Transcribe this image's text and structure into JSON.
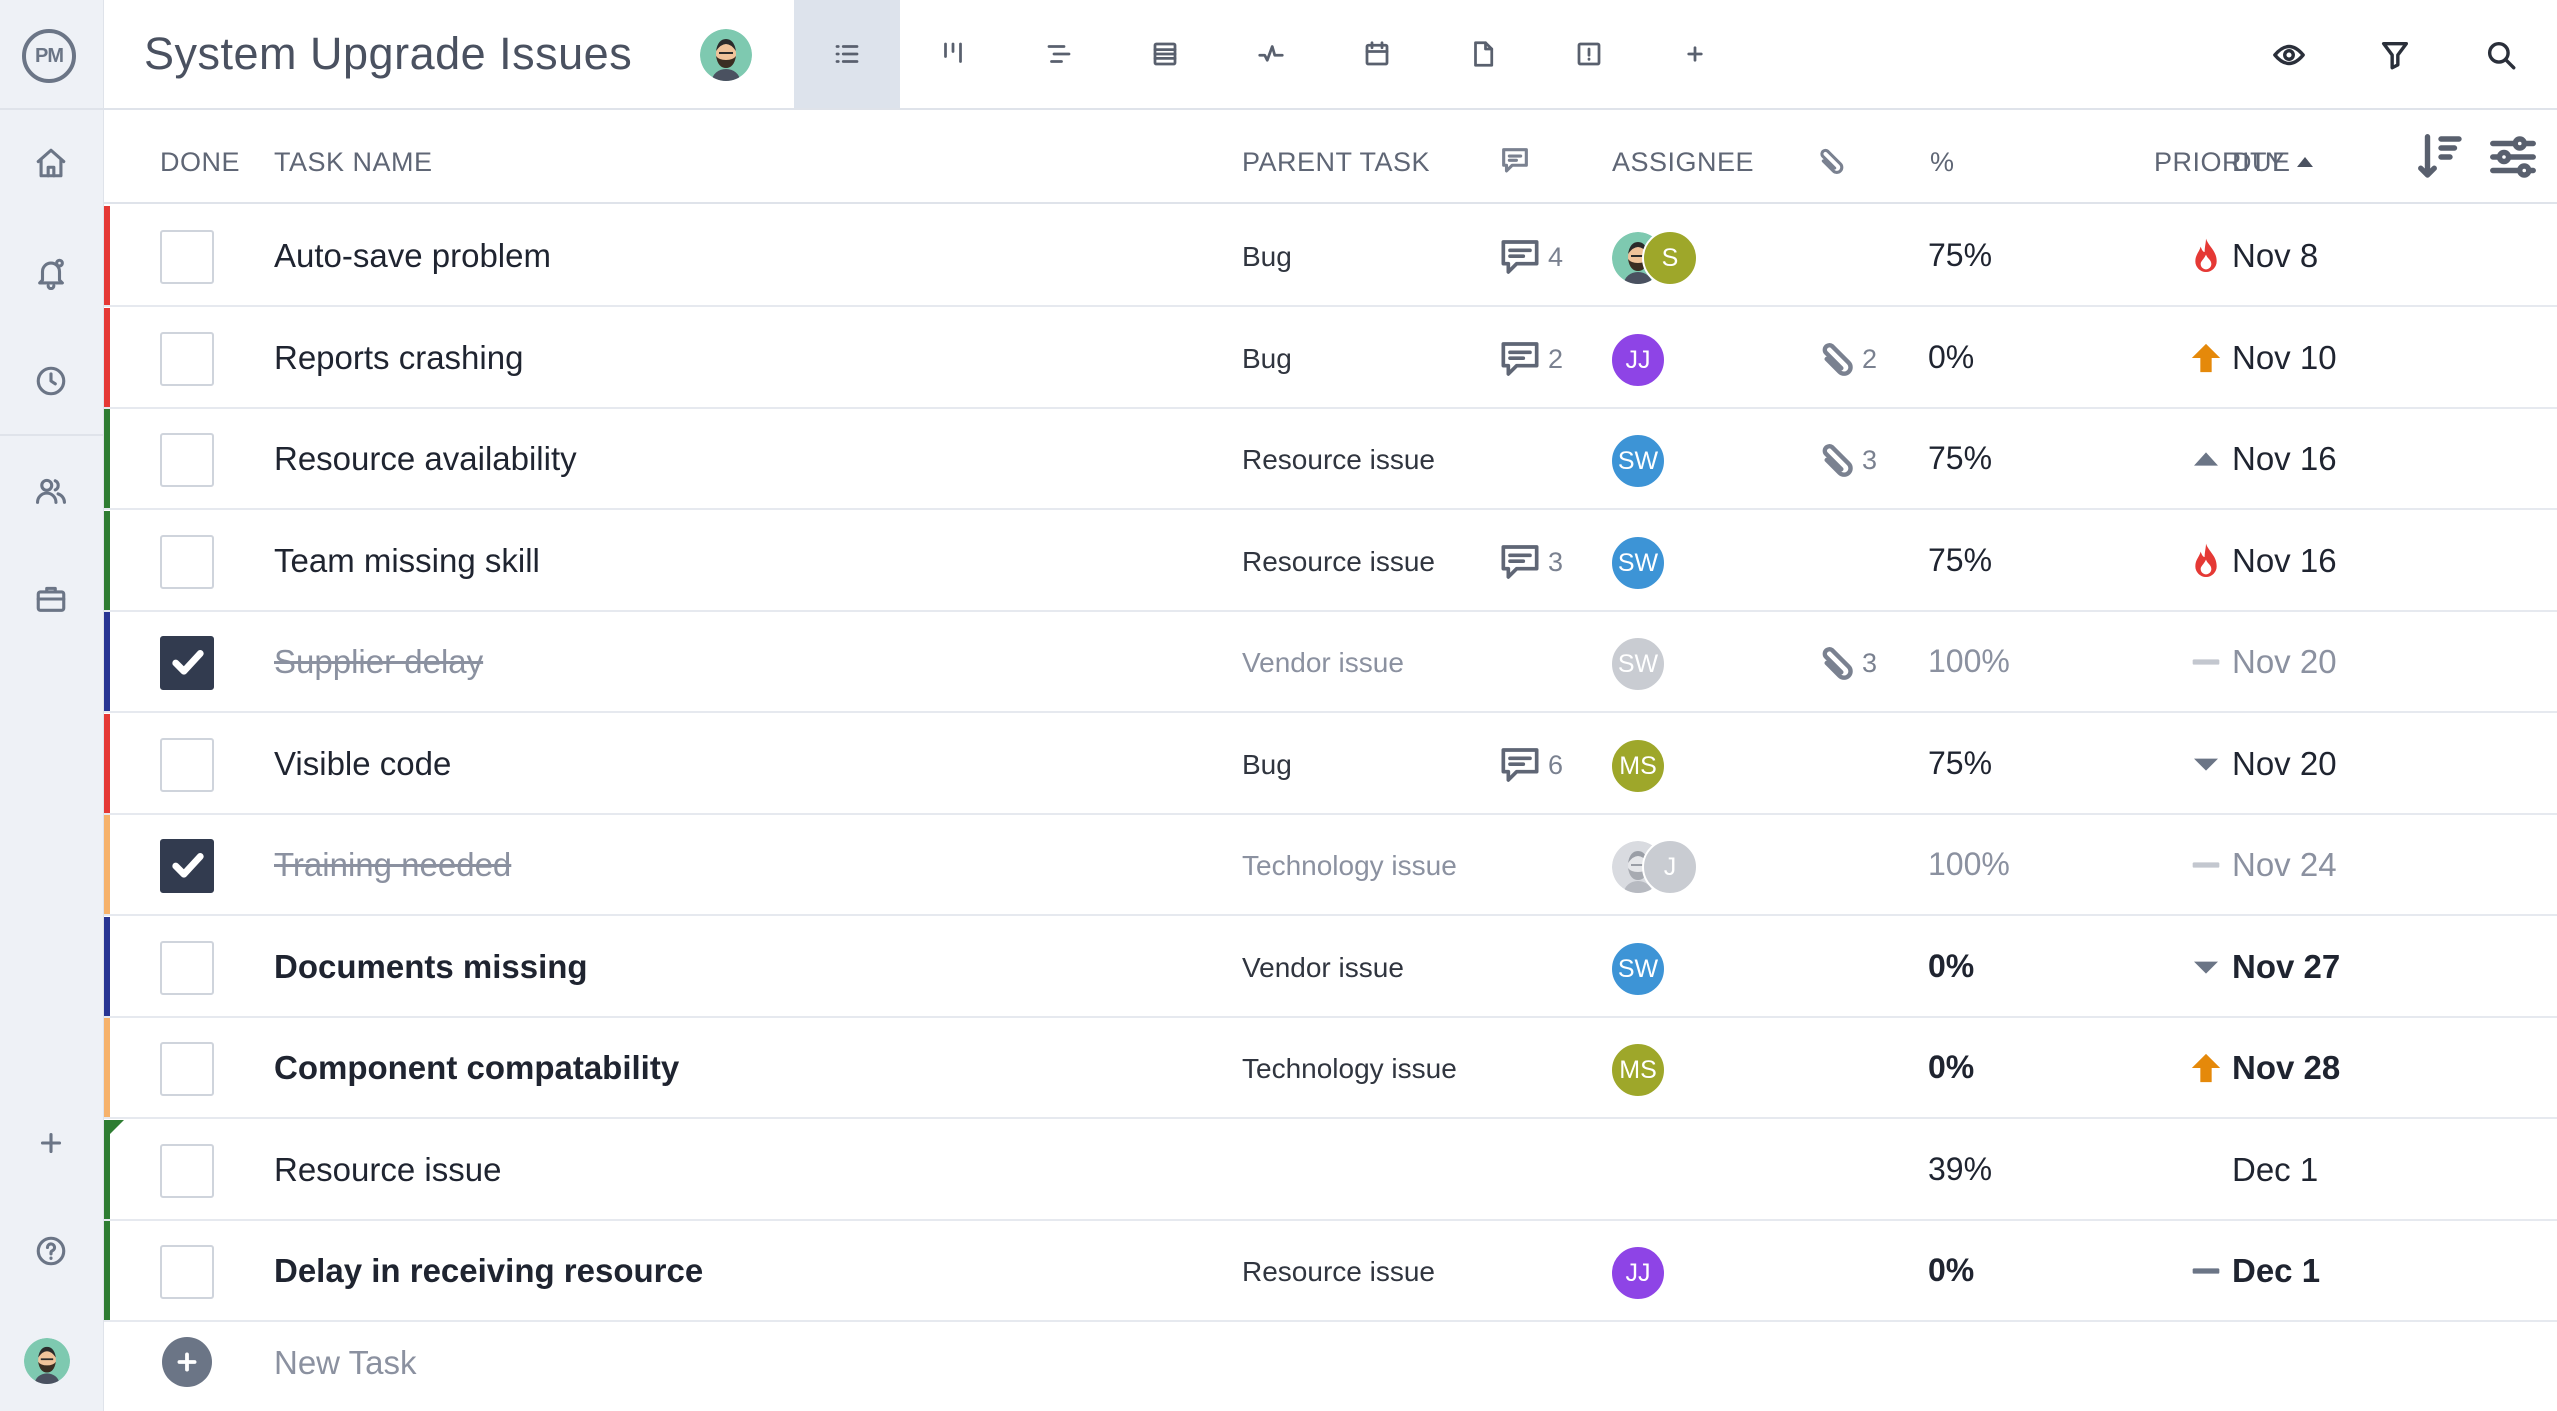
{
  "app": {
    "logo_text": "PM"
  },
  "header": {
    "title": "System Upgrade Issues",
    "views": [
      "list",
      "board",
      "gantt",
      "sheet",
      "dashboard",
      "calendar",
      "files",
      "risks",
      "add"
    ],
    "active_view": "list"
  },
  "columns": {
    "done": "DONE",
    "task_name": "TASK NAME",
    "parent_task": "PARENT TASK",
    "assignee": "ASSIGNEE",
    "percent": "%",
    "priority": "PRIORITY",
    "due": "DUE"
  },
  "colors": {
    "red": "#e53935",
    "green": "#2e7d32",
    "navy": "#283593",
    "orange": "#f6b26b",
    "assignee_purple": "#8e44e6",
    "assignee_blue": "#3d94d6",
    "assignee_olive": "#9ea72a",
    "assignee_grey": "#c9ccd2"
  },
  "tasks": [
    {
      "name": "Auto-save problem",
      "parent": "Bug",
      "comments": "4",
      "attachments": "",
      "percent": "75%",
      "priority": "critical",
      "due": "Nov 8",
      "done": false,
      "bold": false,
      "bar": "red",
      "assignees": [
        {
          "type": "photo"
        },
        {
          "initials": "S",
          "color": "olive"
        }
      ]
    },
    {
      "name": "Reports crashing",
      "parent": "Bug",
      "comments": "2",
      "attachments": "2",
      "percent": "0%",
      "priority": "high",
      "due": "Nov 10",
      "done": false,
      "bold": false,
      "bar": "red",
      "assignees": [
        {
          "initials": "JJ",
          "color": "purple"
        }
      ]
    },
    {
      "name": "Resource availability",
      "parent": "Resource issue",
      "comments": "",
      "attachments": "3",
      "percent": "75%",
      "priority": "medium",
      "due": "Nov 16",
      "done": false,
      "bold": false,
      "bar": "green",
      "assignees": [
        {
          "initials": "SW",
          "color": "blue"
        }
      ]
    },
    {
      "name": "Team missing skill",
      "parent": "Resource issue",
      "comments": "3",
      "attachments": "",
      "percent": "75%",
      "priority": "critical",
      "due": "Nov 16",
      "done": false,
      "bold": false,
      "bar": "green",
      "assignees": [
        {
          "initials": "SW",
          "color": "blue"
        }
      ]
    },
    {
      "name": "Supplier delay",
      "parent": "Vendor issue",
      "comments": "",
      "attachments": "3",
      "percent": "100%",
      "priority": "none",
      "due": "Nov 20",
      "done": true,
      "bold": false,
      "bar": "navy",
      "assignees": [
        {
          "initials": "SW",
          "color": "grey"
        }
      ]
    },
    {
      "name": "Visible code",
      "parent": "Bug",
      "comments": "6",
      "attachments": "",
      "percent": "75%",
      "priority": "low",
      "due": "Nov 20",
      "done": false,
      "bold": false,
      "bar": "red",
      "assignees": [
        {
          "initials": "MS",
          "color": "olive"
        }
      ]
    },
    {
      "name": "Training needed",
      "parent": "Technology issue",
      "comments": "",
      "attachments": "",
      "percent": "100%",
      "priority": "none",
      "due": "Nov 24",
      "done": true,
      "bold": false,
      "bar": "orange",
      "assignees": [
        {
          "type": "photo",
          "grey": true
        },
        {
          "initials": "J",
          "color": "grey"
        }
      ]
    },
    {
      "name": "Documents missing",
      "parent": "Vendor issue",
      "comments": "",
      "attachments": "",
      "percent": "0%",
      "priority": "low",
      "due": "Nov 27",
      "done": false,
      "bold": true,
      "bar": "navy",
      "assignees": [
        {
          "initials": "SW",
          "color": "blue"
        }
      ]
    },
    {
      "name": "Component compatability",
      "parent": "Technology issue",
      "comments": "",
      "attachments": "",
      "percent": "0%",
      "priority": "high",
      "due": "Nov 28",
      "done": false,
      "bold": true,
      "bar": "orange",
      "assignees": [
        {
          "initials": "MS",
          "color": "olive"
        }
      ]
    },
    {
      "name": "Resource issue",
      "parent": "",
      "comments": "",
      "attachments": "",
      "percent": "39%",
      "priority": "",
      "due": "Dec 1",
      "done": false,
      "bold": false,
      "bar": "green",
      "flag": true,
      "assignees": []
    },
    {
      "name": "Delay in receiving resource",
      "parent": "Resource issue",
      "comments": "",
      "attachments": "",
      "percent": "0%",
      "priority": "none-dark",
      "due": "Dec 1",
      "done": false,
      "bold": true,
      "bar": "green",
      "assignees": [
        {
          "initials": "JJ",
          "color": "purple"
        }
      ]
    }
  ],
  "new_task": {
    "label": "New Task"
  }
}
